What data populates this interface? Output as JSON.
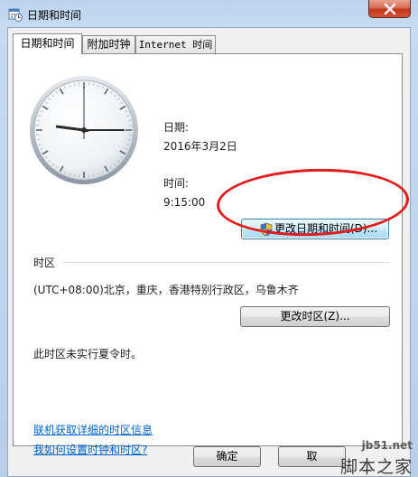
{
  "window": {
    "title": "日期和时间"
  },
  "tabs": [
    {
      "label": "日期和时间"
    },
    {
      "label": "附加时钟"
    },
    {
      "label": "Internet 时间"
    }
  ],
  "datetime": {
    "date_label": "日期:",
    "date_value": "2016年3月2日",
    "time_label": "时间:",
    "time_value": "9:15:00",
    "change_button": "更改日期和时间(D)..."
  },
  "timezone": {
    "section_label": "时区",
    "value": "(UTC+08:00)北京，重庆，香港特别行政区，乌鲁木齐",
    "change_button": "更改时区(Z)...",
    "dst_note": "此时区未实行夏令时。"
  },
  "links": {
    "tz_info": "联机获取详细的时区信息",
    "howto": "我如何设置时钟和时区?"
  },
  "footer": {
    "ok": "确定",
    "cancel": "取"
  },
  "watermark": {
    "url": "jb51.net",
    "text": "脚本之家"
  },
  "clock": {
    "hour": 9,
    "minute": 15,
    "second": 0
  },
  "icons": {
    "app": "calendar-clock-icon",
    "close": "close-icon",
    "shield": "uac-shield-icon"
  },
  "colors": {
    "annotation": "#e31b1b",
    "link": "#0066cc",
    "close_button": "#c2361b"
  }
}
